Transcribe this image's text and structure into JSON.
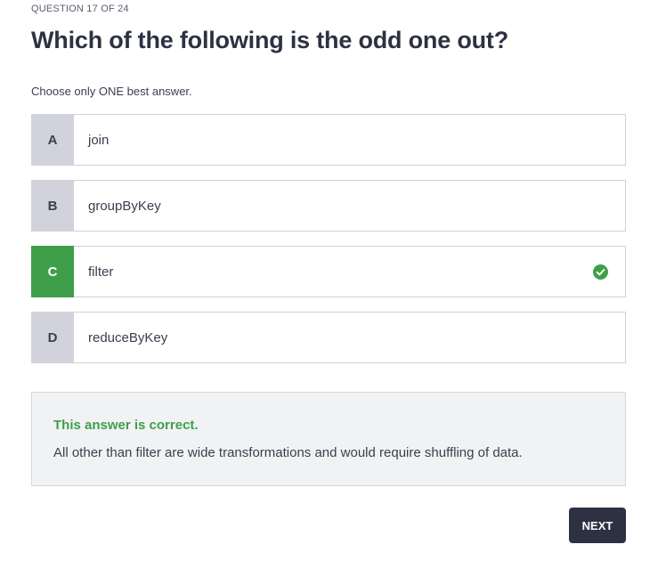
{
  "header": {
    "progress_label": "QUESTION 17 OF 24",
    "question": "Which of the following is the odd one out?",
    "instruction": "Choose only ONE best answer."
  },
  "options": [
    {
      "letter": "A",
      "text": "join",
      "state": "default"
    },
    {
      "letter": "B",
      "text": "groupByKey",
      "state": "default"
    },
    {
      "letter": "C",
      "text": "filter",
      "state": "correct",
      "icon": "check-circle-icon"
    },
    {
      "letter": "D",
      "text": "reduceByKey",
      "state": "default"
    }
  ],
  "feedback": {
    "title": "This answer is correct.",
    "explanation": "All other than filter are wide transformations and would require shuffling of data."
  },
  "actions": {
    "next_label": "NEXT"
  },
  "colors": {
    "correct_green": "#3f9e4a",
    "dark_navy": "#2e3142",
    "letter_gray": "#d1d2db"
  }
}
